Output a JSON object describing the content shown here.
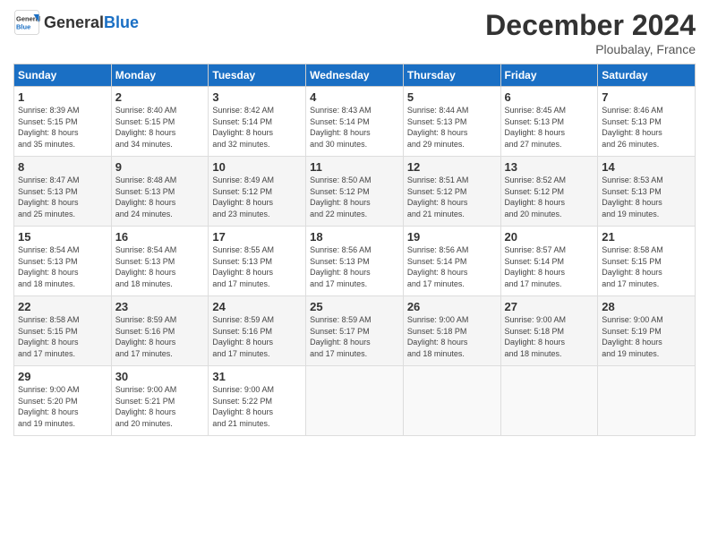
{
  "header": {
    "logo_general": "General",
    "logo_blue": "Blue",
    "title": "December 2024",
    "location": "Ploubalay, France"
  },
  "weekdays": [
    "Sunday",
    "Monday",
    "Tuesday",
    "Wednesday",
    "Thursday",
    "Friday",
    "Saturday"
  ],
  "weeks": [
    [
      {
        "day": "1",
        "sunrise": "8:39 AM",
        "sunset": "5:15 PM",
        "daylight": "8 hours and 35 minutes."
      },
      {
        "day": "2",
        "sunrise": "8:40 AM",
        "sunset": "5:15 PM",
        "daylight": "8 hours and 34 minutes."
      },
      {
        "day": "3",
        "sunrise": "8:42 AM",
        "sunset": "5:14 PM",
        "daylight": "8 hours and 32 minutes."
      },
      {
        "day": "4",
        "sunrise": "8:43 AM",
        "sunset": "5:14 PM",
        "daylight": "8 hours and 30 minutes."
      },
      {
        "day": "5",
        "sunrise": "8:44 AM",
        "sunset": "5:13 PM",
        "daylight": "8 hours and 29 minutes."
      },
      {
        "day": "6",
        "sunrise": "8:45 AM",
        "sunset": "5:13 PM",
        "daylight": "8 hours and 27 minutes."
      },
      {
        "day": "7",
        "sunrise": "8:46 AM",
        "sunset": "5:13 PM",
        "daylight": "8 hours and 26 minutes."
      }
    ],
    [
      {
        "day": "8",
        "sunrise": "8:47 AM",
        "sunset": "5:13 PM",
        "daylight": "8 hours and 25 minutes."
      },
      {
        "day": "9",
        "sunrise": "8:48 AM",
        "sunset": "5:13 PM",
        "daylight": "8 hours and 24 minutes."
      },
      {
        "day": "10",
        "sunrise": "8:49 AM",
        "sunset": "5:12 PM",
        "daylight": "8 hours and 23 minutes."
      },
      {
        "day": "11",
        "sunrise": "8:50 AM",
        "sunset": "5:12 PM",
        "daylight": "8 hours and 22 minutes."
      },
      {
        "day": "12",
        "sunrise": "8:51 AM",
        "sunset": "5:12 PM",
        "daylight": "8 hours and 21 minutes."
      },
      {
        "day": "13",
        "sunrise": "8:52 AM",
        "sunset": "5:12 PM",
        "daylight": "8 hours and 20 minutes."
      },
      {
        "day": "14",
        "sunrise": "8:53 AM",
        "sunset": "5:13 PM",
        "daylight": "8 hours and 19 minutes."
      }
    ],
    [
      {
        "day": "15",
        "sunrise": "8:54 AM",
        "sunset": "5:13 PM",
        "daylight": "8 hours and 18 minutes."
      },
      {
        "day": "16",
        "sunrise": "8:54 AM",
        "sunset": "5:13 PM",
        "daylight": "8 hours and 18 minutes."
      },
      {
        "day": "17",
        "sunrise": "8:55 AM",
        "sunset": "5:13 PM",
        "daylight": "8 hours and 17 minutes."
      },
      {
        "day": "18",
        "sunrise": "8:56 AM",
        "sunset": "5:13 PM",
        "daylight": "8 hours and 17 minutes."
      },
      {
        "day": "19",
        "sunrise": "8:56 AM",
        "sunset": "5:14 PM",
        "daylight": "8 hours and 17 minutes."
      },
      {
        "day": "20",
        "sunrise": "8:57 AM",
        "sunset": "5:14 PM",
        "daylight": "8 hours and 17 minutes."
      },
      {
        "day": "21",
        "sunrise": "8:58 AM",
        "sunset": "5:15 PM",
        "daylight": "8 hours and 17 minutes."
      }
    ],
    [
      {
        "day": "22",
        "sunrise": "8:58 AM",
        "sunset": "5:15 PM",
        "daylight": "8 hours and 17 minutes."
      },
      {
        "day": "23",
        "sunrise": "8:59 AM",
        "sunset": "5:16 PM",
        "daylight": "8 hours and 17 minutes."
      },
      {
        "day": "24",
        "sunrise": "8:59 AM",
        "sunset": "5:16 PM",
        "daylight": "8 hours and 17 minutes."
      },
      {
        "day": "25",
        "sunrise": "8:59 AM",
        "sunset": "5:17 PM",
        "daylight": "8 hours and 17 minutes."
      },
      {
        "day": "26",
        "sunrise": "9:00 AM",
        "sunset": "5:18 PM",
        "daylight": "8 hours and 18 minutes."
      },
      {
        "day": "27",
        "sunrise": "9:00 AM",
        "sunset": "5:18 PM",
        "daylight": "8 hours and 18 minutes."
      },
      {
        "day": "28",
        "sunrise": "9:00 AM",
        "sunset": "5:19 PM",
        "daylight": "8 hours and 19 minutes."
      }
    ],
    [
      {
        "day": "29",
        "sunrise": "9:00 AM",
        "sunset": "5:20 PM",
        "daylight": "8 hours and 19 minutes."
      },
      {
        "day": "30",
        "sunrise": "9:00 AM",
        "sunset": "5:21 PM",
        "daylight": "8 hours and 20 minutes."
      },
      {
        "day": "31",
        "sunrise": "9:00 AM",
        "sunset": "5:22 PM",
        "daylight": "8 hours and 21 minutes."
      },
      null,
      null,
      null,
      null
    ]
  ]
}
